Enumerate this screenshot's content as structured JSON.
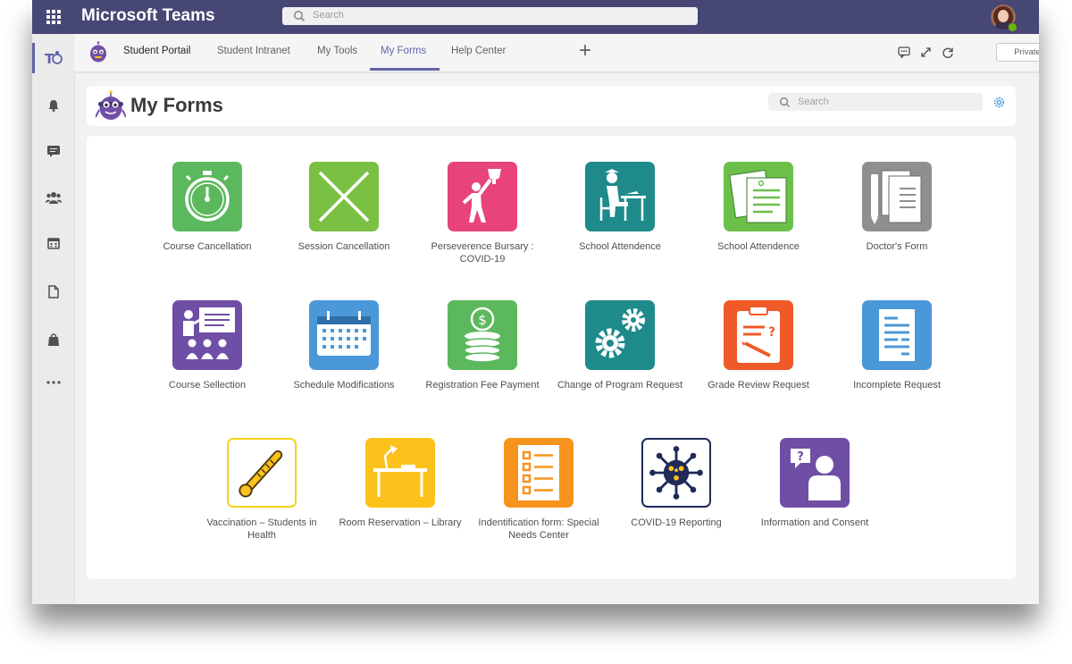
{
  "app": {
    "title": "Microsoft Teams",
    "search_placeholder": "Search"
  },
  "tabs": [
    {
      "label": "Student Portail"
    },
    {
      "label": "Student Intranet"
    },
    {
      "label": "My Tools"
    },
    {
      "label": "My Forms",
      "active": true
    },
    {
      "label": "Help Center"
    }
  ],
  "toolbar": {
    "add_tab": "+",
    "private_label": "Private"
  },
  "page": {
    "title": "My Forms",
    "search_placeholder": "Search"
  },
  "colors": {
    "teams_purple": "#464775",
    "accent": "#6264a7"
  },
  "rail_icons": [
    "teams-icon",
    "bell-icon",
    "chat-icon",
    "people-icon",
    "calendar-icon",
    "files-icon",
    "store-icon",
    "more-icon"
  ],
  "forms": [
    {
      "label": "Course Cancellation",
      "icon": "stopwatch-icon",
      "color": "#5cb85c"
    },
    {
      "label": "Session Cancellation",
      "icon": "x-cross-icon",
      "color": "#7ac143"
    },
    {
      "label": "Perseverence Bursary : COVID-19",
      "icon": "trophy-person-icon",
      "color": "#e8437d"
    },
    {
      "label": "School Attendence",
      "icon": "student-desk-icon",
      "color": "#1e8a8a"
    },
    {
      "label": "School Attendence",
      "icon": "documents-icon",
      "color": "#6cc04a"
    },
    {
      "label": "Doctor's Form",
      "icon": "doctor-form-icon",
      "color": "#8f8f8f"
    },
    {
      "label": "Course Sellection",
      "icon": "classroom-icon",
      "color": "#6f4fa5"
    },
    {
      "label": "Schedule Modifications",
      "icon": "calendar-grid-icon",
      "color": "#4a98d8"
    },
    {
      "label": "Registration Fee Payment",
      "icon": "coin-stack-icon",
      "color": "#5cb85c"
    },
    {
      "label": "Change of Program Request",
      "icon": "gears-icon",
      "color": "#1e8a8a"
    },
    {
      "label": "Grade Review Request",
      "icon": "clipboard-pen-icon",
      "color": "#f05a28"
    },
    {
      "label": "Incomplete Request",
      "icon": "document-lines-icon",
      "color": "#4a98d8"
    },
    {
      "label": "Vaccination – Students in Health",
      "icon": "thermometer-icon",
      "color": "#ffffff"
    },
    {
      "label": "Room Reservation – Library",
      "icon": "lamp-desk-icon",
      "color": "#fcc21b"
    },
    {
      "label": "Indentification form: Special Needs Center",
      "icon": "checklist-icon",
      "color": "#f7941d"
    },
    {
      "label": "COVID-19 Reporting",
      "icon": "virus-icon",
      "color": "#ffffff"
    },
    {
      "label": "Information and Consent",
      "icon": "person-question-icon",
      "color": "#6f4fa5"
    }
  ]
}
